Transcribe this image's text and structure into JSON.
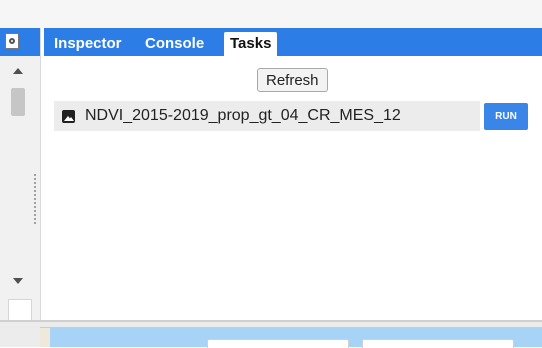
{
  "tabs": [
    {
      "label": "Inspector",
      "active": false
    },
    {
      "label": "Console",
      "active": false
    },
    {
      "label": "Tasks",
      "active": true
    }
  ],
  "tasks_panel": {
    "refresh_label": "Refresh",
    "tasks": [
      {
        "name": "NDVI_2015-2019_prop_gt_04_CR_MES_12",
        "icon": "image-icon",
        "action_label": "RUN"
      }
    ]
  },
  "colors": {
    "tab_bar": "#2d7de6",
    "run_button": "#3a86e8",
    "task_row": "#ececec",
    "map_water": "#a7d3f6"
  }
}
